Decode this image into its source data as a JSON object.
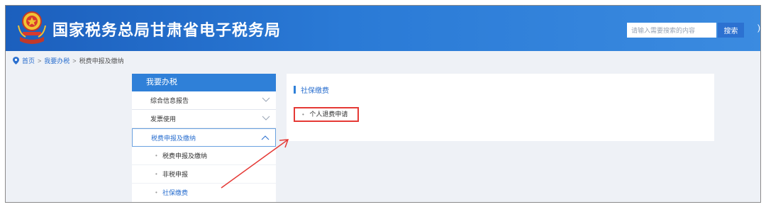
{
  "header": {
    "title": "国家税务总局甘肃省电子税务局",
    "search": {
      "placeholder": "请输入需要搜索的内容",
      "button_label": "搜索"
    },
    "edge_glyph": ")"
  },
  "breadcrumb": {
    "items": [
      "首页",
      "我要办税",
      "税费申报及缴纳"
    ],
    "separator": ">"
  },
  "menu": {
    "header": "我要办税",
    "items": [
      {
        "label": "综合信息报告"
      },
      {
        "label": "发票使用"
      },
      {
        "label": "税费申报及缴纳"
      }
    ],
    "sub_items": [
      {
        "label": "税费申报及缴纳"
      },
      {
        "label": "非税申报"
      },
      {
        "label": "社保缴费"
      }
    ],
    "bullet": "•"
  },
  "panel": {
    "title": "社保缴费",
    "link_label": "个人退费申请",
    "bullet": "•"
  },
  "colors": {
    "header_blue": "#1c5fbd",
    "accent_blue": "#2f80d8",
    "highlight_red": "#e53935"
  }
}
